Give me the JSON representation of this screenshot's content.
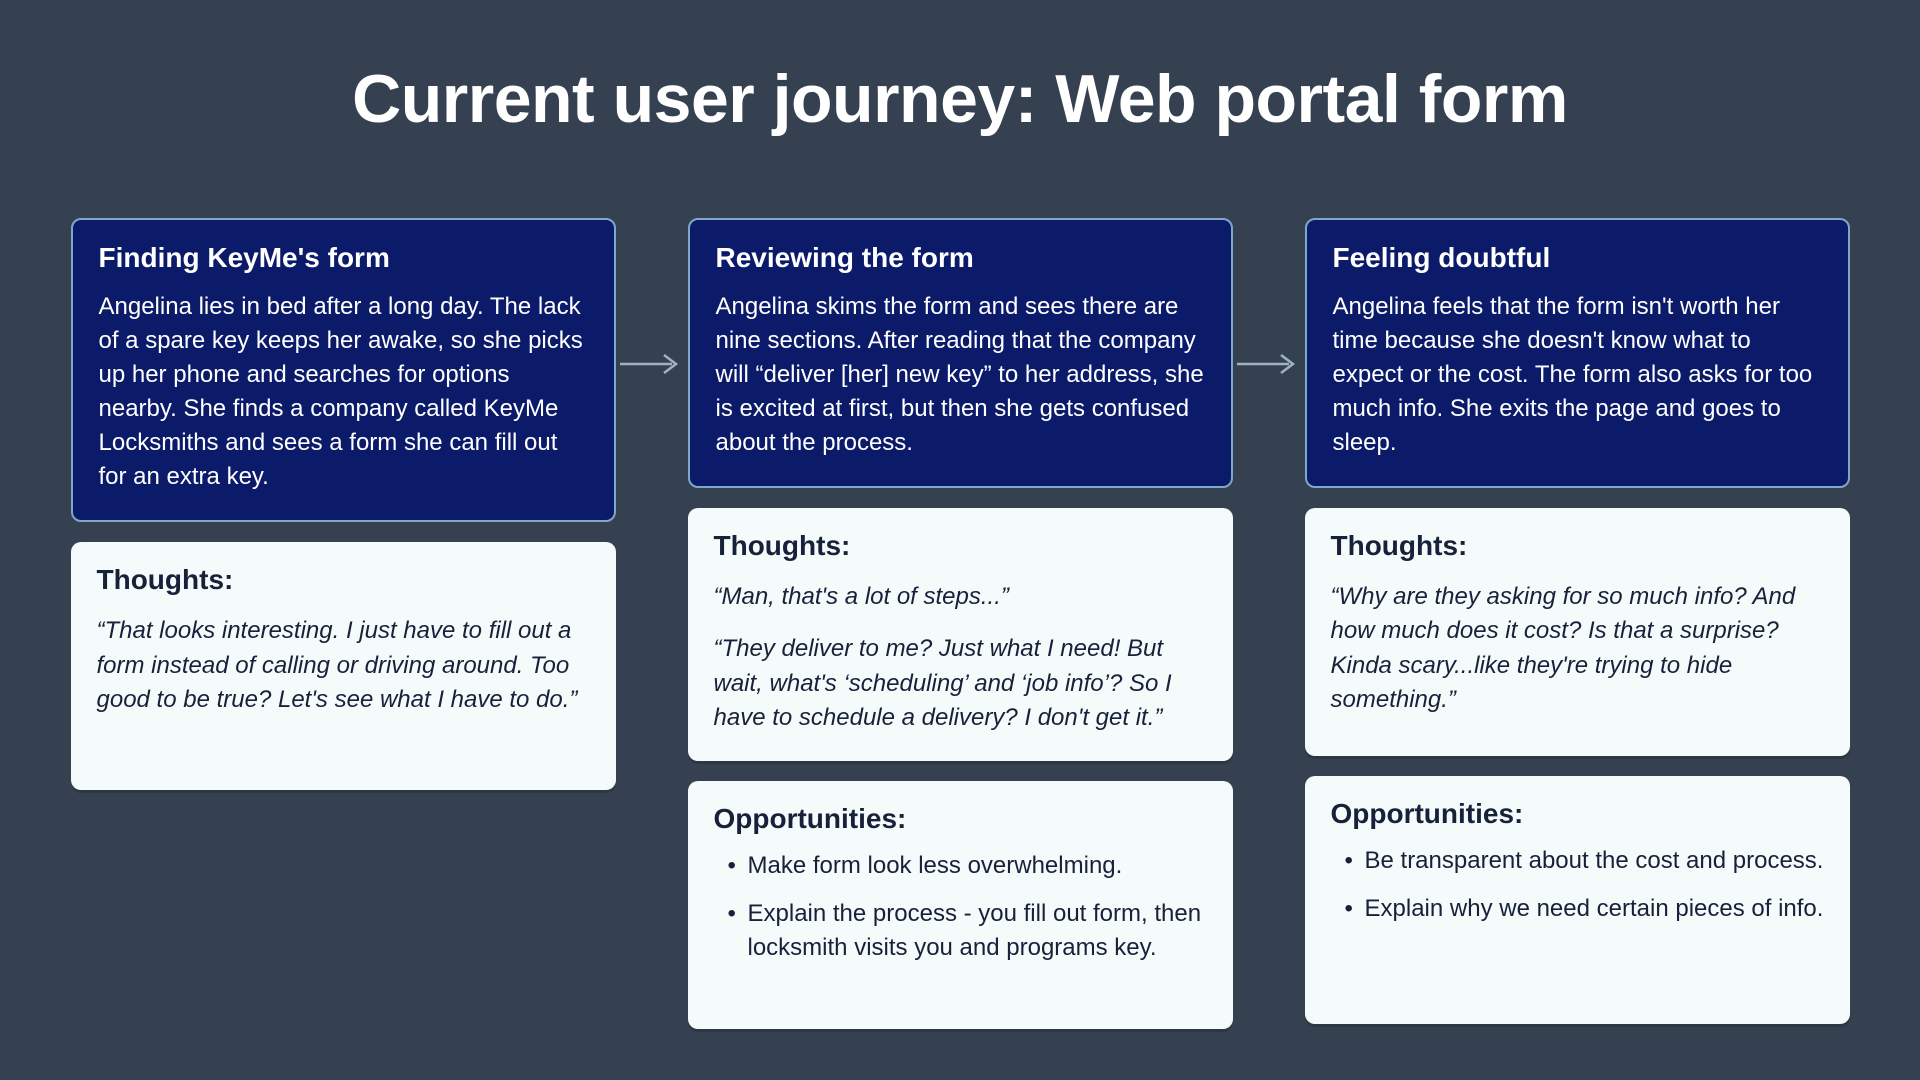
{
  "title": "Current user journey: Web portal form",
  "labels": {
    "thoughts": "Thoughts:",
    "opportunities": "Opportunities:"
  },
  "steps": [
    {
      "title": "Finding KeyMe's form",
      "body": "Angelina lies in bed after a long day. The lack of a spare key keeps her awake, so she picks up her phone and searches for options nearby. She finds a company called KeyMe Locksmiths and sees a form she can fill out for an extra key.",
      "thoughts": [
        "“That looks interesting. I just have to fill out a form instead of calling or driving around. Too good to be true? Let's see what I have to do.”"
      ],
      "opportunities": []
    },
    {
      "title": "Reviewing the form",
      "body": "Angelina skims the form and sees there are nine sections. After reading that the company will “deliver [her] new key” to her address, she is excited at first, but then she gets confused about the process.",
      "thoughts": [
        "“Man, that's a lot of steps...”",
        "“They deliver to me? Just what I need! But wait, what's ‘scheduling’ and ‘job info’? So I have to schedule a delivery? I don't get it.”"
      ],
      "opportunities": [
        "Make form look less overwhelming.",
        "Explain the process - you fill out form, then locksmith visits you and programs key."
      ]
    },
    {
      "title": "Feeling doubtful",
      "body": "Angelina feels that the form isn't worth her time because she doesn't know what to expect or the cost. The form also asks for too much info. She exits the page and goes to sleep.",
      "thoughts": [
        "“Why are they asking for so much info? And how much does it cost? Is that a surprise? Kinda scary...like they're trying to hide something.”"
      ],
      "opportunities": [
        "Be transparent about the cost and process.",
        "Explain why we need certain pieces of info."
      ]
    }
  ]
}
